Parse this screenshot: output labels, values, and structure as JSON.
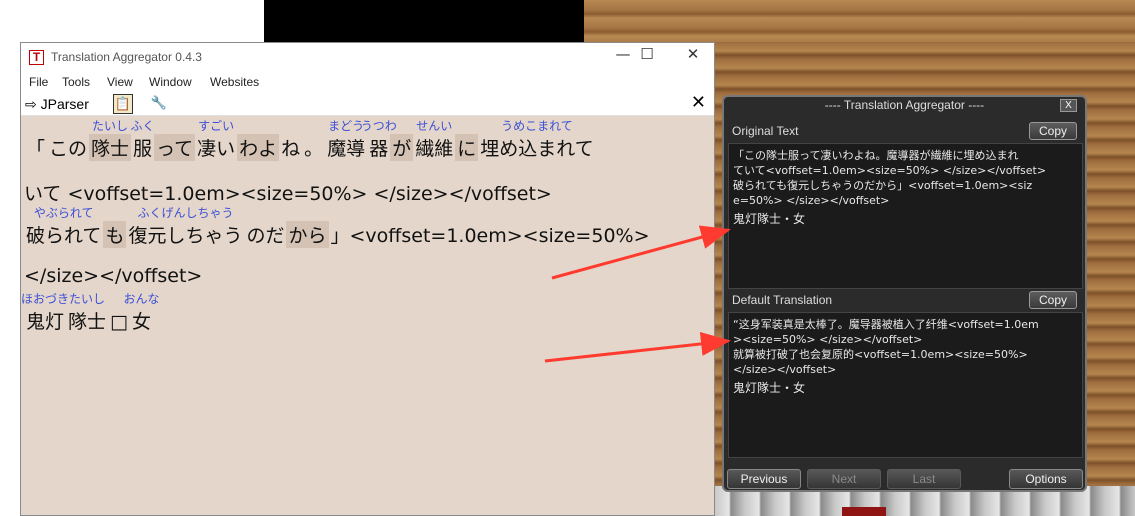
{
  "colors": {
    "accent_red": "#ff3b30",
    "ruby_blue": "#3b4fd8",
    "panel_bg": "#2b2b2b"
  },
  "main_window": {
    "title": "Translation Aggregator 0.4.3",
    "icon_letter": "T",
    "controls": {
      "minimize": "—",
      "maximize": "☐",
      "close": "✕"
    },
    "menu": [
      "File",
      "Tools",
      "View",
      "Window",
      "Websites"
    ],
    "toolbar": {
      "parser_label": "⇨ JParser",
      "clipboard_icon": "clipboard-icon",
      "tool_icon": "wrench-icon",
      "close": "✕"
    }
  },
  "parsed_text": {
    "line1": [
      {
        "t": "「",
        "r": ""
      },
      {
        "t": "この",
        "r": ""
      },
      {
        "t": "隊士",
        "r": "たいし",
        "h": true
      },
      {
        "t": "服",
        "r": "ふく"
      },
      {
        "t": "って",
        "r": "",
        "h": true
      },
      {
        "t": "凄い",
        "r": "すごい"
      },
      {
        "t": "わよ",
        "r": "",
        "h": true
      },
      {
        "t": "ね",
        "r": ""
      },
      {
        "t": "。",
        "r": ""
      },
      {
        "t": "魔導",
        "r": "まどう"
      },
      {
        "t": "器",
        "r": "うつわ"
      },
      {
        "t": "が",
        "r": "",
        "h": true
      },
      {
        "t": "繊維",
        "r": "せんい"
      },
      {
        "t": "に",
        "r": "",
        "h": true
      },
      {
        "t": "埋め込まれて",
        "r": "うめこまれて"
      }
    ],
    "line2": "いて <voffset=1.0em><size=50%> </size></voffset>",
    "line3": [
      {
        "t": "破られて",
        "r": "やぶられて"
      },
      {
        "t": "も",
        "r": "",
        "h": true
      },
      {
        "t": "復元しちゃう",
        "r": "ふくげんしちゃう"
      },
      {
        "t": "のだ",
        "r": ""
      },
      {
        "t": "から",
        "r": "",
        "h": true
      },
      {
        "t": "」<voffset=1.0em><size=50%>",
        "r": ""
      }
    ],
    "line4": "</size></voffset>",
    "line5": [
      {
        "t": "鬼灯",
        "r": "ほおづき"
      },
      {
        "t": "隊士",
        "r": "たいし"
      },
      {
        "t": "□",
        "r": ""
      },
      {
        "t": "女",
        "r": "おんな"
      }
    ]
  },
  "overlay": {
    "title": "---- Translation Aggregator ----",
    "close": "X",
    "original": {
      "label": "Original Text",
      "copy": "Copy",
      "lines": [
        "「この隊士服って凄いわよね。魔導器が繊維に埋め込まれ",
        "ていて<voffset=1.0em><size=50%> </size></voffset>",
        "   破られても復元しちゃうのだから」<voffset=1.0em><siz",
        "e=50%> </size></voffset>"
      ],
      "name": "鬼灯隊士・女"
    },
    "translation": {
      "label": "Default Translation",
      "copy": "Copy",
      "lines": [
        "“这身军装真是太棒了。魔导器被植入了纤维<voffset=1.0em",
        "><size=50%> </size></voffset>",
        "   就算被打破了也会复原的<voffset=1.0em><size=50%>",
        "</size></voffset>"
      ],
      "name": "鬼灯隊士・女"
    },
    "buttons": {
      "previous": "Previous",
      "next": "Next",
      "last": "Last",
      "options": "Options"
    }
  }
}
